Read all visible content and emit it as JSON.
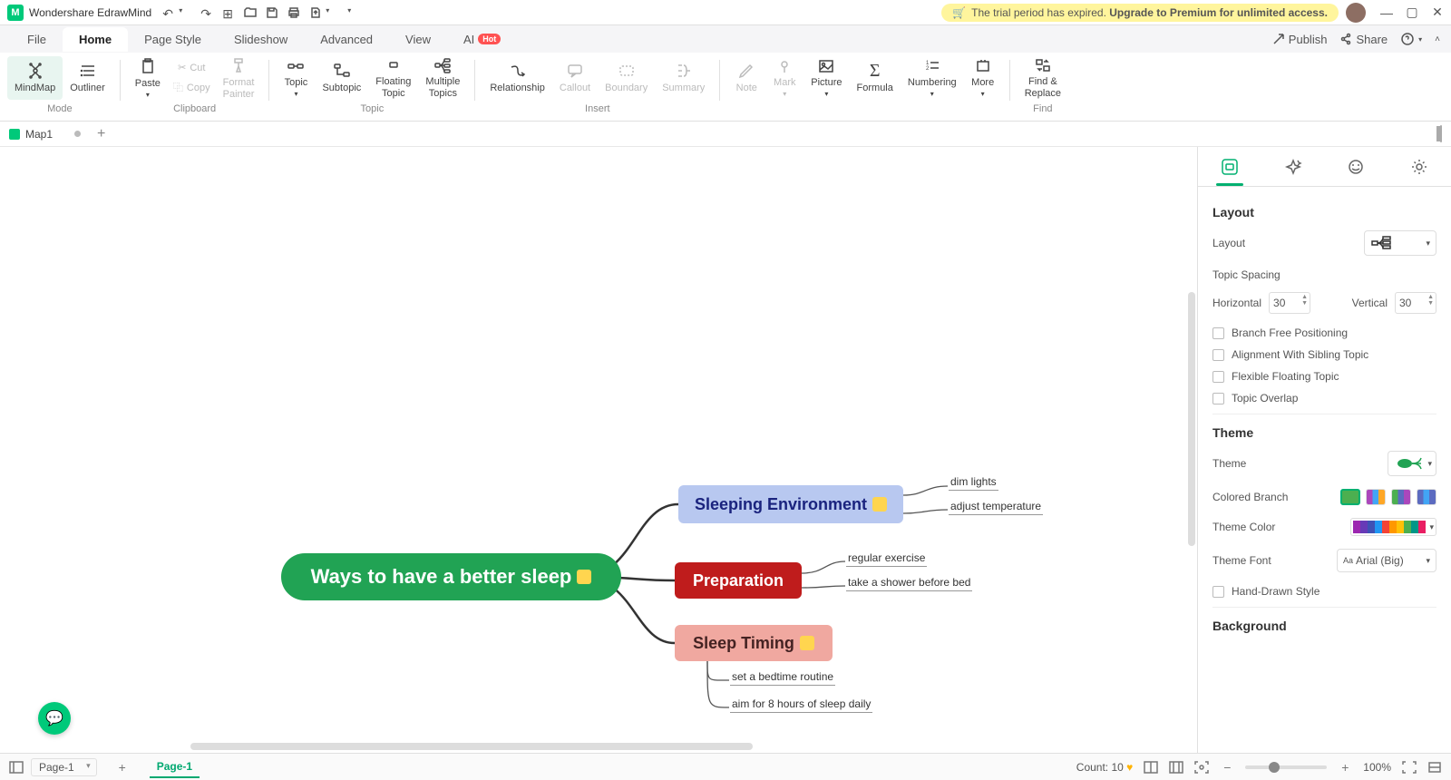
{
  "app": {
    "title": "Wondershare EdrawMind"
  },
  "trialBanner": "The trial period has expired. Upgrade to Premium for unlimited access.",
  "menu": {
    "file": "File",
    "home": "Home",
    "pageStyle": "Page Style",
    "slideshow": "Slideshow",
    "advanced": "Advanced",
    "view": "View",
    "ai": "AI",
    "hot": "Hot",
    "publish": "Publish",
    "share": "Share"
  },
  "ribbon": {
    "mindmap": "MindMap",
    "outliner": "Outliner",
    "paste": "Paste",
    "cut": "Cut",
    "copy": "Copy",
    "formatPainter": "Format\nPainter",
    "topic": "Topic",
    "subtopic": "Subtopic",
    "floatingTopic": "Floating\nTopic",
    "multipleTopics": "Multiple\nTopics",
    "relationship": "Relationship",
    "callout": "Callout",
    "boundary": "Boundary",
    "summary": "Summary",
    "note": "Note",
    "mark": "Mark",
    "picture": "Picture",
    "formula": "Formula",
    "numbering": "Numbering",
    "more": "More",
    "findReplace": "Find &\nReplace",
    "groups": {
      "mode": "Mode",
      "clipboard": "Clipboard",
      "topic": "Topic",
      "insert": "Insert",
      "find": "Find"
    }
  },
  "docTabs": {
    "map1": "Map1"
  },
  "mindmap": {
    "root": "Ways to have a  better sleep",
    "branch1": "Sleeping Environment",
    "branch1_leaves": [
      "dim lights",
      "adjust temperature"
    ],
    "branch2": "Preparation",
    "branch2_leaves": [
      "regular exercise",
      "take a shower before bed"
    ],
    "branch3": "Sleep Timing",
    "branch3_leaves": [
      "set a bedtime routine",
      "aim for 8 hours of sleep daily"
    ]
  },
  "rightPanel": {
    "sections": {
      "layout": "Layout",
      "theme": "Theme",
      "background": "Background"
    },
    "layout": "Layout",
    "topicSpacing": "Topic Spacing",
    "horizontal": "Horizontal",
    "horizontalVal": "30",
    "vertical": "Vertical",
    "verticalVal": "30",
    "branchFree": "Branch Free Positioning",
    "alignSibling": "Alignment With Sibling Topic",
    "flexFloating": "Flexible Floating Topic",
    "topicOverlap": "Topic Overlap",
    "themeLabel": "Theme",
    "coloredBranch": "Colored Branch",
    "themeColor": "Theme Color",
    "themeFont": "Theme Font",
    "fontValue": "Arial (Big)",
    "handDrawn": "Hand-Drawn Style"
  },
  "bottomBar": {
    "pageDropdown": "Page-1",
    "pageTab": "Page-1",
    "count": "Count: 10",
    "zoom": "100%"
  }
}
